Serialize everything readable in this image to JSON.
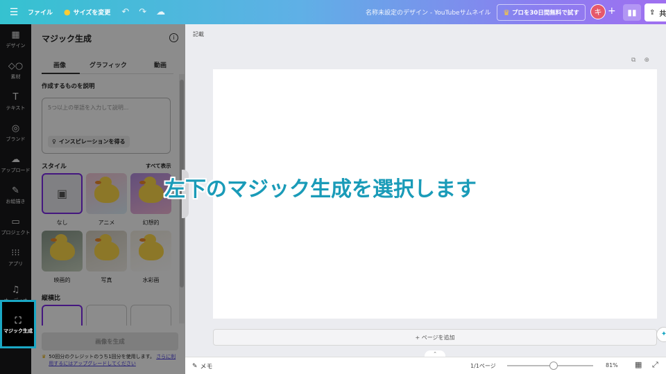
{
  "topbar": {
    "menu_icon": "hamburger-icon",
    "file_label": "ファイル",
    "resize_label": "サイズを変更",
    "design_title": "名称未設定のデザイン - YouTubeサムネイル",
    "pro_trial_label": "プロを30日間無料で試す",
    "avatar_initial": "キ",
    "share_label": "共"
  },
  "rail": {
    "items": [
      {
        "label": "デザイン",
        "icon": "layout-icon"
      },
      {
        "label": "素材",
        "icon": "elements-icon"
      },
      {
        "label": "テキスト",
        "icon": "text-icon"
      },
      {
        "label": "ブランド",
        "icon": "brand-icon"
      },
      {
        "label": "アップロード",
        "icon": "cloud-upload-icon"
      },
      {
        "label": "お絵描き",
        "icon": "draw-icon"
      },
      {
        "label": "プロジェクト",
        "icon": "folder-icon"
      },
      {
        "label": "アプリ",
        "icon": "apps-grid-icon"
      },
      {
        "label": "オーディオ",
        "icon": "music-icon"
      }
    ],
    "active": {
      "label": "マジック生成",
      "icon": "magic-image-icon"
    }
  },
  "panel": {
    "title": "マジック生成",
    "tabs": [
      "画像",
      "グラフィック",
      "動画"
    ],
    "describe_label": "作成するものを説明",
    "prompt_placeholder": "5つ以上の単語を入力して説明...",
    "inspiration_label": "インスピレーションを得る",
    "style_label": "スタイル",
    "see_all": "すべて表示",
    "styles": [
      "なし",
      "アニメ",
      "幻想的",
      "映画的",
      "写真",
      "水彩画"
    ],
    "ratio_label": "縦横比",
    "generate_button": "画像を生成",
    "credit_text": "50回分のクレジットのうち1回分を使用します。",
    "credit_link": "さらに利用するにはアップグレードしてください"
  },
  "canvas": {
    "notes_top": "記載",
    "add_page": "+ ページを追加"
  },
  "bottombar": {
    "notes_label": "メモ",
    "pages": "1/1ページ",
    "zoom": "81%",
    "zoom_fraction": 0.5
  },
  "caption": "左下のマジック生成を選択します",
  "colors": {
    "accent": "#7d2ae8",
    "caption": "#1a9bb8",
    "highlight_border": "#1aa7c4"
  }
}
